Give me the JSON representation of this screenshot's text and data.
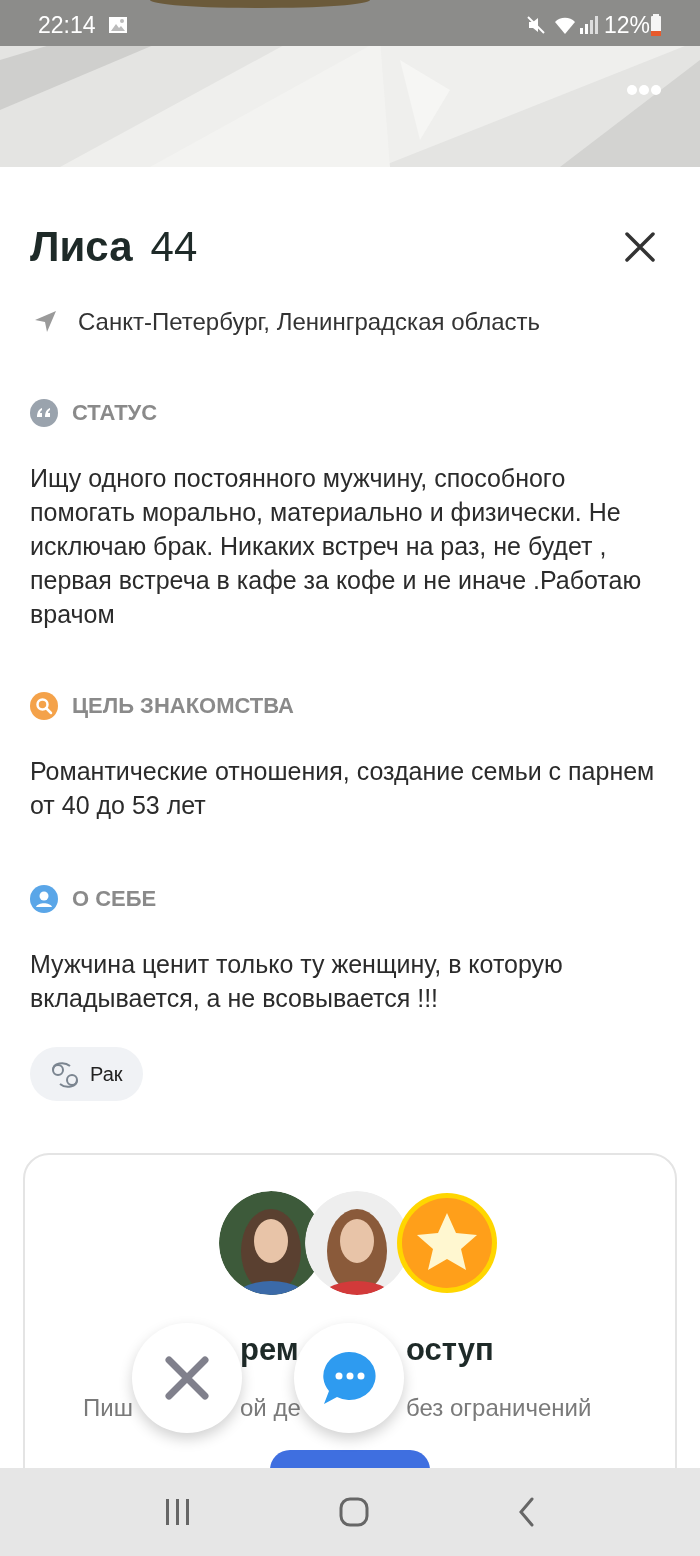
{
  "status_bar": {
    "time": "22:14",
    "battery": "12%"
  },
  "profile": {
    "name": "Лиса",
    "age": "44",
    "location": "Санкт-Петербург, Ленинградская область"
  },
  "sections": [
    {
      "kind": "status",
      "heading": "СТАТУС",
      "text": "Ищу одного постоянного мужчину, способного помогать морально, материально и физически. Не исключаю брак. Никаких встреч на раз, не будет , первая встреча в кафе за кофе и не иначе .Работаю врачом"
    },
    {
      "kind": "goal",
      "heading": "ЦЕЛЬ ЗНАКОМСТВА",
      "text": "Романтические отношения, создание семьи с парнем от 40 до 53 лет"
    },
    {
      "kind": "about",
      "heading": "О СЕБЕ",
      "text": "Мужчина ценит только ту женщину, в которую вкладывается, а не всовывается !!!"
    }
  ],
  "tags": [
    {
      "kind": "zodiac",
      "label": "Рак"
    }
  ],
  "premium_card": {
    "title_visible_parts": [
      "рем",
      "оступ"
    ],
    "subtitle_visible_parts": [
      "Пиш",
      "ой де",
      "без ограничений"
    ]
  }
}
